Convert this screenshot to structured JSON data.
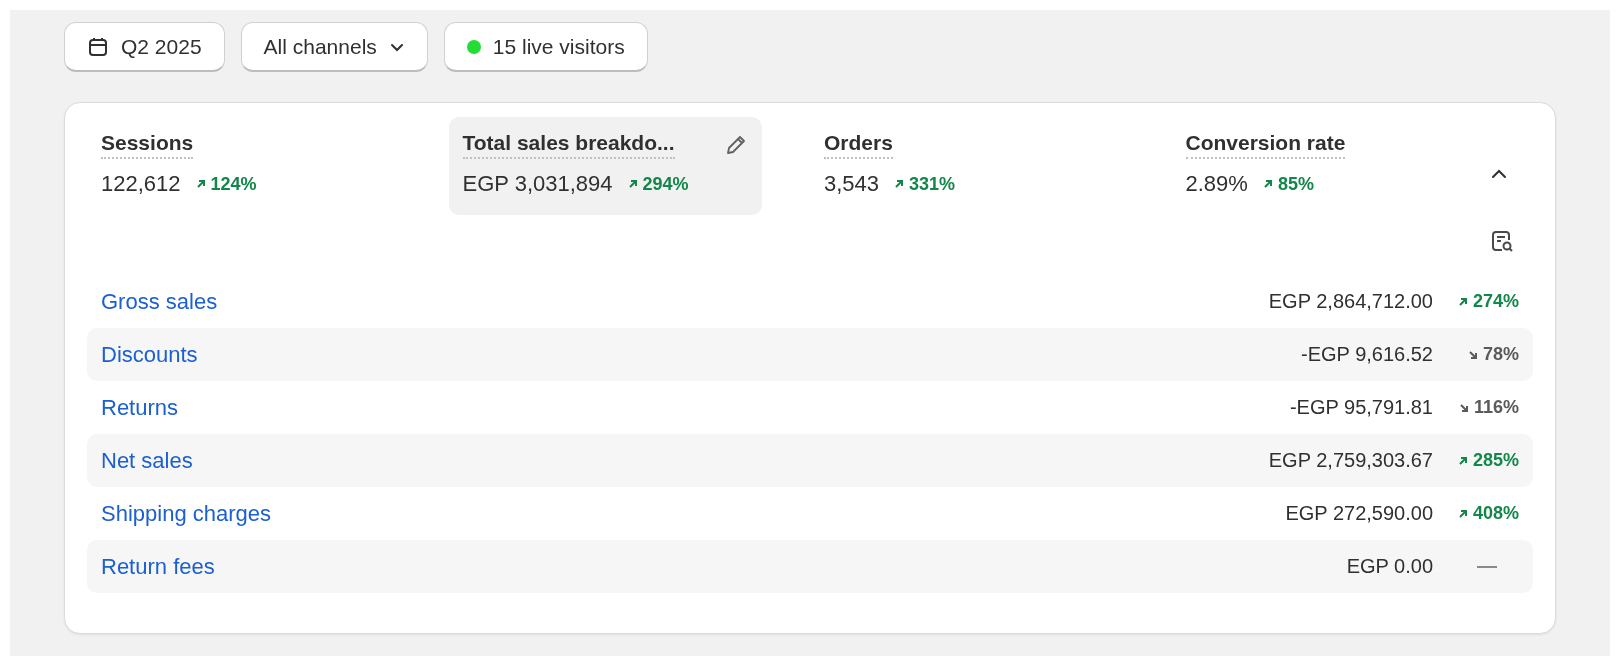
{
  "toolbar": {
    "date_range": "Q2 2025",
    "channel_filter": "All channels",
    "live": {
      "label": "15 live visitors",
      "color": "#22dd33"
    }
  },
  "metrics": [
    {
      "label": "Sessions",
      "value": "122,612",
      "kind": "up",
      "change": "124%",
      "selected": false
    },
    {
      "label": "Total sales breakdo...",
      "value": "EGP 3,031,894",
      "kind": "up",
      "change": "294%",
      "selected": true
    },
    {
      "label": "Orders",
      "value": "3,543",
      "kind": "up",
      "change": "331%",
      "selected": false
    },
    {
      "label": "Conversion rate",
      "value": "2.89%",
      "kind": "up",
      "change": "85%",
      "selected": false
    }
  ],
  "breakdown": [
    {
      "label": "Gross sales",
      "value": "EGP 2,864,712.00",
      "kind": "up",
      "change": "274%"
    },
    {
      "label": "Discounts",
      "value": "-EGP 9,616.52",
      "kind": "down",
      "change": "78%"
    },
    {
      "label": "Returns",
      "value": "-EGP 95,791.81",
      "kind": "down",
      "change": "116%"
    },
    {
      "label": "Net sales",
      "value": "EGP 2,759,303.67",
      "kind": "up",
      "change": "285%"
    },
    {
      "label": "Shipping charges",
      "value": "EGP 272,590.00",
      "kind": "up",
      "change": "408%"
    },
    {
      "label": "Return fees",
      "value": "EGP 0.00",
      "kind": "none"
    }
  ]
}
